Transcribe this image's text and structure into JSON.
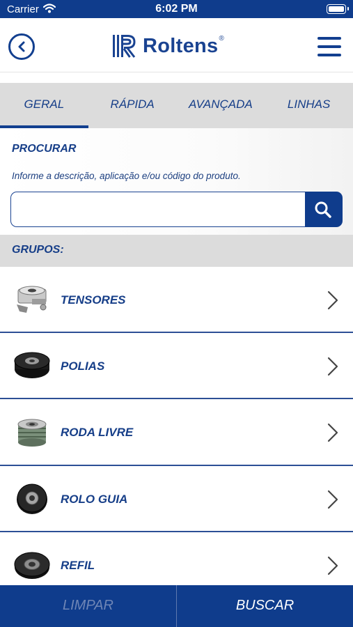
{
  "status_bar": {
    "carrier": "Carrier",
    "time": "6:02 PM"
  },
  "header": {
    "logo_text": "Roltens",
    "logo_reg": "®"
  },
  "tabs": [
    {
      "label": "GERAL",
      "active": true
    },
    {
      "label": "RÁPIDA",
      "active": false
    },
    {
      "label": "AVANÇADA",
      "active": false
    },
    {
      "label": "LINHAS",
      "active": false
    }
  ],
  "search": {
    "title": "PROCURAR",
    "hint": "Informe a descrição, aplicação e/ou código do produto.",
    "value": "",
    "placeholder": ""
  },
  "groups": {
    "title": "GRUPOS:",
    "items": [
      {
        "label": "TENSORES",
        "icon": "tensioner-icon"
      },
      {
        "label": "POLIAS",
        "icon": "pulley-icon"
      },
      {
        "label": "RODA LIVRE",
        "icon": "freewheel-icon"
      },
      {
        "label": "ROLO GUIA",
        "icon": "idler-roller-icon"
      },
      {
        "label": "REFIL",
        "icon": "bearing-refill-icon"
      }
    ]
  },
  "bottom": {
    "clear_label": "LIMPAR",
    "search_label": "BUSCAR"
  },
  "colors": {
    "brand_blue": "#0f3c8c",
    "text_blue": "#163e88",
    "tab_bg": "#dcdcdc",
    "disabled": "#6f86b6"
  }
}
